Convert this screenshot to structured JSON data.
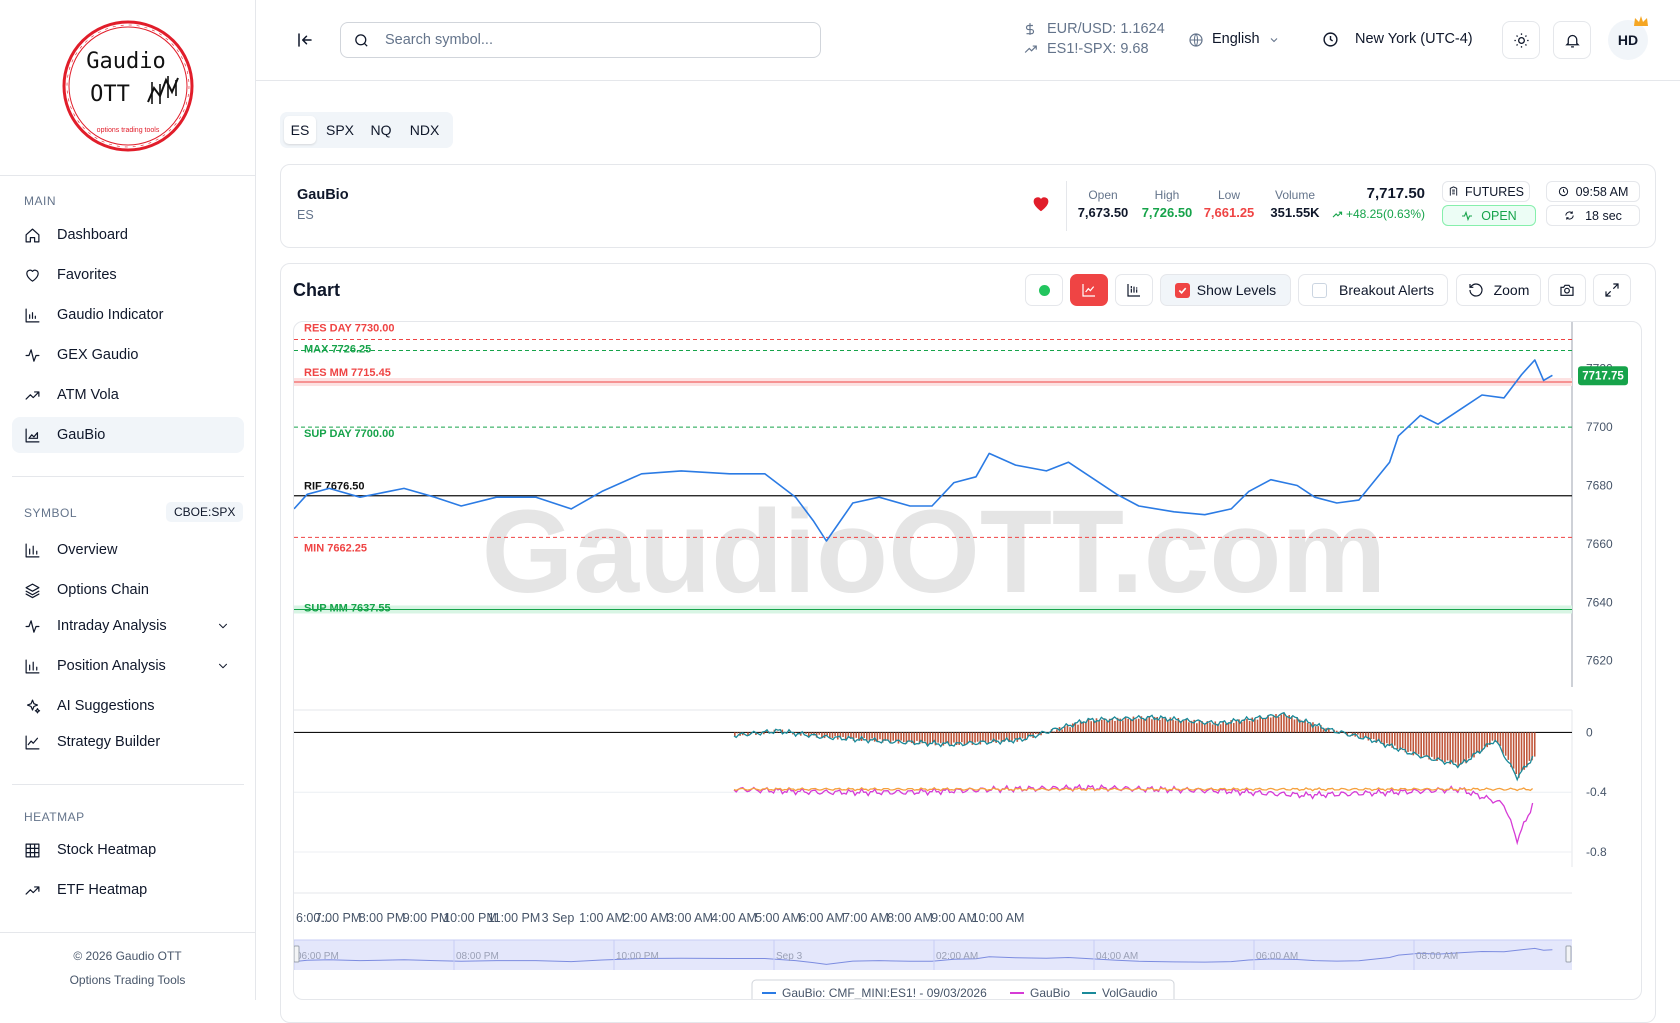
{
  "sidebar": {
    "logo": {
      "line1": "Gaudio",
      "line2": "OTT",
      "tagline": "options trading tools"
    },
    "main_header": "MAIN",
    "main_items": [
      {
        "label": "Dashboard",
        "icon": "home-icon"
      },
      {
        "label": "Favorites",
        "icon": "heart-icon"
      },
      {
        "label": "Gaudio Indicator",
        "icon": "chart-bars-icon"
      },
      {
        "label": "GEX Gaudio",
        "icon": "activity-icon"
      },
      {
        "label": "ATM Vola",
        "icon": "trend-icon"
      },
      {
        "label": "GauBio",
        "icon": "area-chart-icon",
        "active": true
      }
    ],
    "symbol_header": "SYMBOL",
    "symbol_badge": "CBOE:SPX",
    "symbol_items": [
      {
        "label": "Overview",
        "icon": "bar-chart-icon"
      },
      {
        "label": "Options Chain",
        "icon": "layers-icon"
      },
      {
        "label": "Intraday Analysis",
        "icon": "activity-icon",
        "expandable": true
      },
      {
        "label": "Position Analysis",
        "icon": "bar-chart-icon",
        "expandable": true
      },
      {
        "label": "AI Suggestions",
        "icon": "sparkles-icon"
      },
      {
        "label": "Strategy Builder",
        "icon": "line-chart-icon"
      }
    ],
    "heatmap_header": "HEATMAP",
    "heatmap_items": [
      {
        "label": "Stock Heatmap",
        "icon": "grid-icon"
      },
      {
        "label": "ETF Heatmap",
        "icon": "trend-icon"
      }
    ],
    "footer_line1": "© 2026 Gaudio OTT",
    "footer_line2": "Options Trading Tools"
  },
  "topbar": {
    "search_placeholder": "Search symbol...",
    "eurusd": "EUR/USD: 1.1624",
    "es_spx": "ES1!-SPX: 9.68",
    "language": "English",
    "timezone": "New York (UTC-4)",
    "avatar": "HD"
  },
  "symbol_tabs": [
    "ES",
    "SPX",
    "NQ",
    "NDX"
  ],
  "active_tab": "ES",
  "quote": {
    "name": "GauBio",
    "symbol": "ES",
    "open_label": "Open",
    "open": "7,673.50",
    "high_label": "High",
    "high": "7,726.50",
    "low_label": "Low",
    "low": "7,661.25",
    "volume_label": "Volume",
    "volume": "351.55K",
    "price": "7,717.50",
    "change": "+48.25(0.63%)",
    "market_type": "FUTURES",
    "status": "OPEN",
    "time": "09:58 AM",
    "refresh": "18 sec"
  },
  "chart_panel": {
    "title": "Chart",
    "show_levels": "Show Levels",
    "show_levels_checked": true,
    "breakout_alerts": "Breakout Alerts",
    "breakout_checked": false,
    "zoom": "Zoom",
    "watermark": "GaudioOTT.com"
  },
  "colors": {
    "red": "#ef4444",
    "green": "#16a34a",
    "blue": "#2b7be4",
    "teal": "#1a8a9a",
    "magenta": "#d63bd6",
    "orange": "#f5a03c",
    "bars": "#c0563a"
  },
  "chart_data": {
    "type": "line",
    "price_ylim": [
      7611,
      7736
    ],
    "price_ticks": [
      7720,
      7700,
      7680,
      7660,
      7640,
      7620
    ],
    "last_price": 7717.75,
    "last_price_label": "7717.75",
    "levels": [
      {
        "label": "RES DAY 7730.00",
        "value": 7730.0,
        "kind": "res"
      },
      {
        "label": "MAX 7726.25",
        "value": 7726.25,
        "kind": "sup"
      },
      {
        "label": "RES MM 7715.45",
        "value": 7715.45,
        "kind": "res"
      },
      {
        "label": "SUP DAY 7700.00",
        "value": 7700.0,
        "kind": "sup"
      },
      {
        "label": "RIF 7676.50",
        "value": 7676.5,
        "kind": "ref"
      },
      {
        "label": "MIN 7662.25",
        "value": 7662.25,
        "kind": "res"
      },
      {
        "label": "SUP MM 7637.55",
        "value": 7637.55,
        "kind": "sup"
      }
    ],
    "price_series": [
      [
        0,
        7672
      ],
      [
        0.3,
        7677
      ],
      [
        0.8,
        7679
      ],
      [
        1.5,
        7676
      ],
      [
        2.5,
        7679
      ],
      [
        3.2,
        7676
      ],
      [
        3.8,
        7673
      ],
      [
        4.6,
        7676
      ],
      [
        5.5,
        7676
      ],
      [
        6.3,
        7672
      ],
      [
        7.0,
        7678
      ],
      [
        7.9,
        7684
      ],
      [
        8.8,
        7685
      ],
      [
        9.9,
        7684
      ],
      [
        10.7,
        7684
      ],
      [
        11.4,
        7676
      ],
      [
        11.8,
        7668
      ],
      [
        12.1,
        7661
      ],
      [
        12.7,
        7674
      ],
      [
        13.3,
        7676
      ],
      [
        14.0,
        7673
      ],
      [
        14.5,
        7673
      ],
      [
        15.0,
        7681
      ],
      [
        15.5,
        7683
      ],
      [
        15.8,
        7691
      ],
      [
        16.4,
        7687
      ],
      [
        17.1,
        7685
      ],
      [
        17.6,
        7688
      ],
      [
        18.2,
        7682
      ],
      [
        18.7,
        7677
      ],
      [
        19.2,
        7673
      ],
      [
        20.0,
        7671
      ],
      [
        20.7,
        7670
      ],
      [
        21.3,
        7672
      ],
      [
        21.7,
        7678
      ],
      [
        22.2,
        7682
      ],
      [
        22.8,
        7680
      ],
      [
        23.2,
        7676
      ],
      [
        23.7,
        7674
      ],
      [
        24.2,
        7675
      ],
      [
        24.9,
        7688
      ],
      [
        25.1,
        7697
      ],
      [
        25.6,
        7704
      ],
      [
        26.0,
        7701
      ],
      [
        26.6,
        7707
      ],
      [
        27.0,
        7711
      ],
      [
        27.5,
        7710
      ],
      [
        27.9,
        7718
      ],
      [
        28.2,
        7723
      ],
      [
        28.4,
        7716
      ],
      [
        28.6,
        7717.75
      ]
    ],
    "osc_ylim": [
      -0.9,
      0.15
    ],
    "osc_ticks": [
      0,
      -0.4,
      -0.8
    ],
    "series": [
      {
        "name": "GauBio: CMF_MINI:ES1! - 09/03/2026",
        "values": [
          [
            10.0,
            -0.02
          ],
          [
            11.0,
            0.01
          ],
          [
            12.0,
            -0.03
          ],
          [
            13.5,
            -0.06
          ],
          [
            15.0,
            -0.08
          ],
          [
            16.5,
            -0.05
          ],
          [
            18.0,
            0.08
          ],
          [
            19.5,
            0.1
          ],
          [
            21.0,
            0.06
          ],
          [
            22.5,
            0.12
          ],
          [
            23.5,
            0.02
          ],
          [
            24.5,
            -0.05
          ],
          [
            25.5,
            -0.15
          ],
          [
            26.5,
            -0.22
          ],
          [
            27.3,
            -0.05
          ],
          [
            27.8,
            -0.3
          ],
          [
            28.2,
            -0.15
          ]
        ]
      },
      {
        "name": "GauBio",
        "values": [
          [
            10.0,
            -0.38
          ],
          [
            12.0,
            -0.4
          ],
          [
            14.0,
            -0.4
          ],
          [
            16.0,
            -0.38
          ],
          [
            18.0,
            -0.37
          ],
          [
            19.5,
            -0.38
          ],
          [
            21.0,
            -0.39
          ],
          [
            23.0,
            -0.42
          ],
          [
            25.0,
            -0.4
          ],
          [
            26.5,
            -0.38
          ],
          [
            27.5,
            -0.48
          ],
          [
            27.8,
            -0.72
          ],
          [
            28.2,
            -0.45
          ]
        ]
      },
      {
        "name": "VolGaudio",
        "values": [
          [
            10.0,
            -0.38
          ],
          [
            28.2,
            -0.38
          ]
        ]
      }
    ],
    "x_ticks": [
      "6:00...",
      "7:00 PM",
      "8:00 PM",
      "9:00 PM",
      "10:00 PM",
      "11:00 PM",
      "3 Sep",
      "1:00 AM",
      "2:00 AM",
      "3:00 AM",
      "4:00 AM",
      "5:00 AM",
      "6:00 AM",
      "7:00 AM",
      "8:00 AM",
      "9:00 AM",
      "10:00 AM"
    ],
    "navigator_ticks": [
      "06:00 PM",
      "08:00 PM",
      "10:00 PM",
      "Sep 3",
      "02:00 AM",
      "04:00 AM",
      "06:00 AM",
      "08:00 AM"
    ],
    "legend": [
      "GauBio: CMF_MINI:ES1! - 09/03/2026",
      "GauBio",
      "VolGaudio"
    ]
  }
}
